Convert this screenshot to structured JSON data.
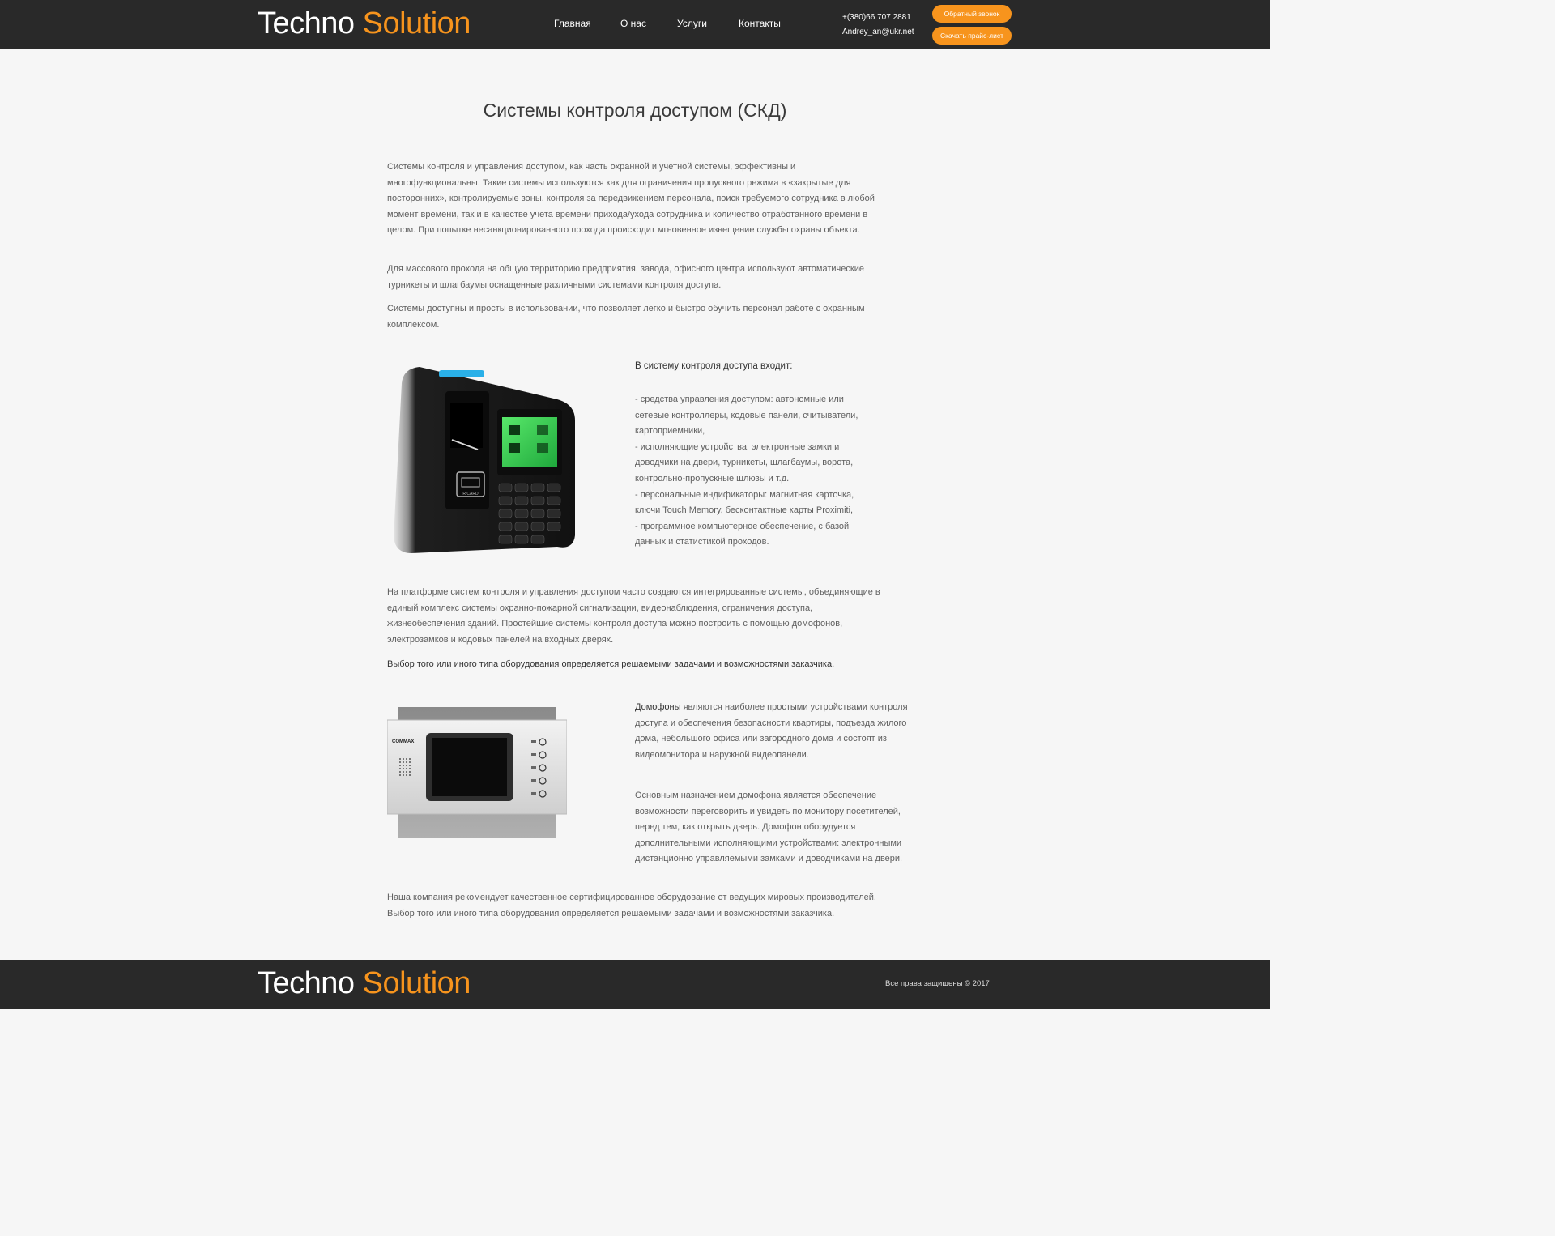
{
  "header": {
    "logo_part1": "Techno",
    "logo_part2": "Solution",
    "nav": [
      "Главная",
      "О нас",
      "Услуги",
      "Контакты"
    ],
    "phone": "+(380)66 707 2881",
    "email": "Andrey_an@ukr.net",
    "callback_btn": "Обратный звонок",
    "pricelist_btn": "Скачать прайс-лист"
  },
  "main": {
    "title": "Системы контроля доступом (СКД)",
    "paragraph1": "Системы контроля и управления доступом, как часть охранной и учетной системы, эффективны и многофункциональны. Такие системы используются как для ограничения пропускного режима в «закрытые для посторонних», контролируемые зоны, контроля за передвижением персонала, поиск требуемого сотрудника в любой момент времени, так и в качестве учета времени прихода/ухода сотрудника и количество отработанного времени в целом.  При попытке несанкционированного прохода происходит мгновенное извещение службы охраны объекта.",
    "paragraph2": "Для массового прохода на общую территорию предприятия, завода, офисного центра используют автоматические турникеты и шлагбаумы оснащенные различными системами контроля доступа.",
    "paragraph3": "Системы доступны и просты в использовании, что позволяет легко и быстро обучить персонал работе с охранным комплексом.",
    "list_title": "В систему контроля доступа входит:",
    "list_items": [
      "- средства управления доступом: автономные или сетевые контроллеры, кодовые панели, считыватели, картоприемники,",
      "- исполняющие устройства: электронные замки и доводчики на двери, турникеты, шлагбаумы, ворота, контрольно-пропускные шлюзы и т.д.",
      "- персональные индификаторы: магнитная карточка, ключи Touch Memory,  бесконтактные карты Proximiti,",
      "- программное компьютерное обеспечение, с базой данных и статистикой проходов."
    ],
    "paragraph4": "На платформе систем контроля и управления доступом часто создаются интегрированные системы, объединяющие в единый комплекс системы охранно-пожарной сигнализации, видеонаблюдения, ограничения доступа, жизнеобеспечения зданий. Простейшие системы контроля доступа можно построить с помощью домофонов, электрозамков и кодовых панелей на входных дверях.",
    "paragraph5": "Выбор того или иного типа оборудования определяется решаемыми задачами и возможностями заказчика.",
    "intercom_strong": "Домофоны",
    "intercom_text": " являются наиболее простыми устройствами контроля доступа и обеспечения безопасности квартиры, подъезда жилого дома, небольшого офиса или загородного дома и состоят из видеомонитора и наружной видеопанели.",
    "paragraph6": "Основным назначением домофона является обеспечение возможности переговорить и увидеть по монитору посетителей, перед тем, как открыть дверь. Домофон оборудуется дополнительными исполняющими устройствами: электронными дистанционно управляемыми замками и доводчиками на двери.",
    "paragraph7": "Наша компания рекомендует качественное сертифицированное оборудование от ведущих мировых производителей. Выбор того или иного типа оборудования определяется решаемыми задачами и возможностями заказчика.",
    "device1_labels": [
      "IR CARD"
    ],
    "device2_brand": "COMMAX"
  },
  "footer": {
    "logo_part1": "Techno",
    "logo_part2": "Solution",
    "copyright": "Все права защищены © 2017"
  },
  "colors": {
    "accent": "#f7941d",
    "header_bg": "#292929",
    "page_bg": "#f6f6f6"
  }
}
